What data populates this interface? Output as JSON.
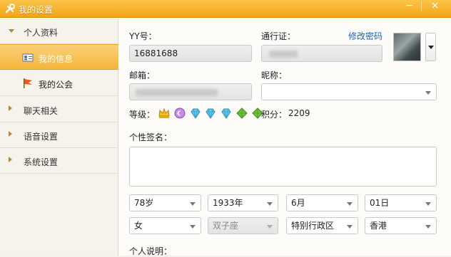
{
  "window": {
    "title": "我的设置",
    "minimize_glyph": "−",
    "close_glyph": "×"
  },
  "sidebar": {
    "groups": [
      {
        "label": "个人资料",
        "expanded": true
      },
      {
        "label": "聊天相关",
        "expanded": false
      },
      {
        "label": "语音设置",
        "expanded": false
      },
      {
        "label": "系统设置",
        "expanded": false
      }
    ],
    "subitems": [
      {
        "label": "我的信息",
        "icon": "id-card-icon",
        "active": true
      },
      {
        "label": "我的公会",
        "icon": "flag-icon",
        "active": false
      }
    ]
  },
  "form": {
    "yy_label": "YY号：",
    "yy_value": "16881688",
    "passport_label": "通行证：",
    "change_password_link": "修改密码",
    "email_label": "邮箱：",
    "nickname_label": "昵称：",
    "nickname_value": "",
    "level_label": "等级：",
    "level_icons": [
      "crown-icon",
      "moon-icon",
      "diamond-icon",
      "diamond-icon",
      "diamond-icon",
      "leaf-icon",
      "leaf-icon"
    ],
    "points_label": "积分：",
    "points_value": "2209",
    "signature_label": "个性签名：",
    "signature_value": "",
    "age": "78岁",
    "birth_year": "1933年",
    "birth_month": "6月",
    "birth_day": "01日",
    "gender": "女",
    "zodiac": "双子座",
    "region": "特别行政区",
    "city": "香港",
    "description_label": "个人说明："
  },
  "colors": {
    "title_bar": "#f2a516",
    "active_item": "#f5b53b",
    "link": "#1a63b8"
  }
}
